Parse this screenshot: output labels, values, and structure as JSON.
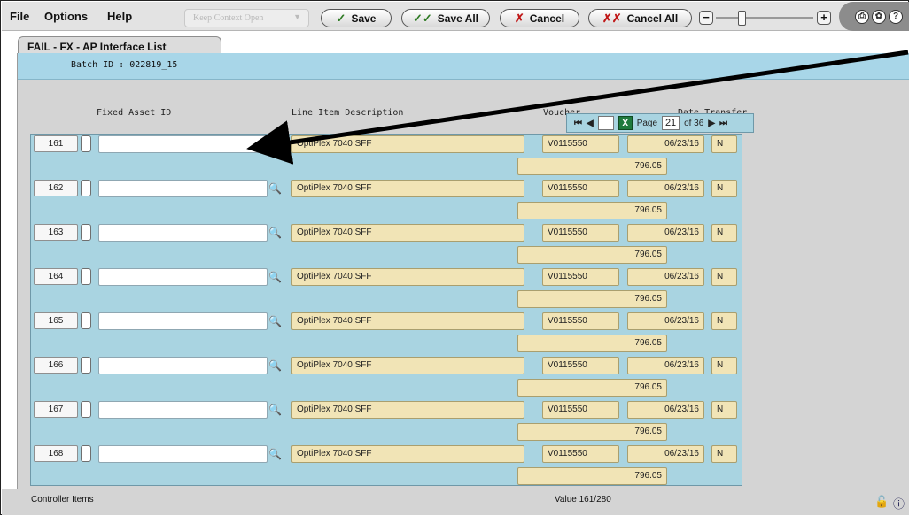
{
  "menu": {
    "file": "File",
    "options": "Options",
    "help": "Help"
  },
  "toolbar": {
    "keep_context": "Keep Context Open",
    "save": "Save",
    "save_all": "Save All",
    "cancel": "Cancel",
    "cancel_all": "Cancel All",
    "zoom_minus": "−",
    "zoom_plus": "+"
  },
  "tab": {
    "title": "FAIL - FX - AP Interface List"
  },
  "batch": {
    "label": "Batch ID : 022819_15"
  },
  "columns": {
    "fixed_asset_id": "Fixed Asset ID",
    "line_item": "Line Item Description",
    "voucher": "Voucher",
    "date_transfer": "Date  Transfer"
  },
  "pager": {
    "page_label": "Page",
    "page": "21",
    "of_label": "of 36"
  },
  "rows": [
    {
      "num": "161",
      "desc": "OptiPlex 7040 SFF",
      "voucher": "V0115550",
      "date": "06/23/16",
      "flag": "N",
      "amount": "796.05"
    },
    {
      "num": "162",
      "desc": "OptiPlex 7040 SFF",
      "voucher": "V0115550",
      "date": "06/23/16",
      "flag": "N",
      "amount": "796.05"
    },
    {
      "num": "163",
      "desc": "OptiPlex 7040 SFF",
      "voucher": "V0115550",
      "date": "06/23/16",
      "flag": "N",
      "amount": "796.05"
    },
    {
      "num": "164",
      "desc": "OptiPlex 7040 SFF",
      "voucher": "V0115550",
      "date": "06/23/16",
      "flag": "N",
      "amount": "796.05"
    },
    {
      "num": "165",
      "desc": "OptiPlex 7040 SFF",
      "voucher": "V0115550",
      "date": "06/23/16",
      "flag": "N",
      "amount": "796.05"
    },
    {
      "num": "166",
      "desc": "OptiPlex 7040 SFF",
      "voucher": "V0115550",
      "date": "06/23/16",
      "flag": "N",
      "amount": "796.05"
    },
    {
      "num": "167",
      "desc": "OptiPlex 7040 SFF",
      "voucher": "V0115550",
      "date": "06/23/16",
      "flag": "N",
      "amount": "796.05"
    },
    {
      "num": "168",
      "desc": "OptiPlex 7040 SFF",
      "voucher": "V0115550",
      "date": "06/23/16",
      "flag": "N",
      "amount": "796.05"
    }
  ],
  "status": {
    "left": "Controller Items",
    "center": "Value 161/280"
  }
}
